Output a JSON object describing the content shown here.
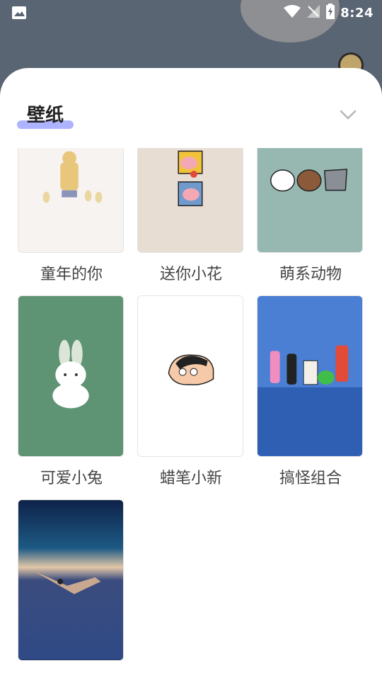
{
  "status": {
    "time": "8:24"
  },
  "sheet": {
    "title": "壁纸"
  },
  "wallpapers": [
    {
      "label": "童年的你",
      "bg": "#f7f3f0"
    },
    {
      "label": "送你小花",
      "bg": "#e8ddd3"
    },
    {
      "label": "萌系动物",
      "bg": "#97b8b1"
    },
    {
      "label": "可爱小兔",
      "bg": "#5e9373"
    },
    {
      "label": "蜡笔小新",
      "bg": "#ffffff"
    },
    {
      "label": "搞怪组合",
      "bg": "#3f73cf"
    },
    {
      "label": "",
      "bg": "#1c2c4d"
    }
  ],
  "icons": {
    "gallery": "image-icon",
    "wifi": "wifi-icon",
    "signal": "no-signal-icon",
    "battery": "battery-charging-icon",
    "chevron": "chevron-down-icon"
  },
  "colors": {
    "title_highlight": "#aeb3ff",
    "sheet_bg": "#ffffff",
    "backdrop": "#5a6573"
  }
}
